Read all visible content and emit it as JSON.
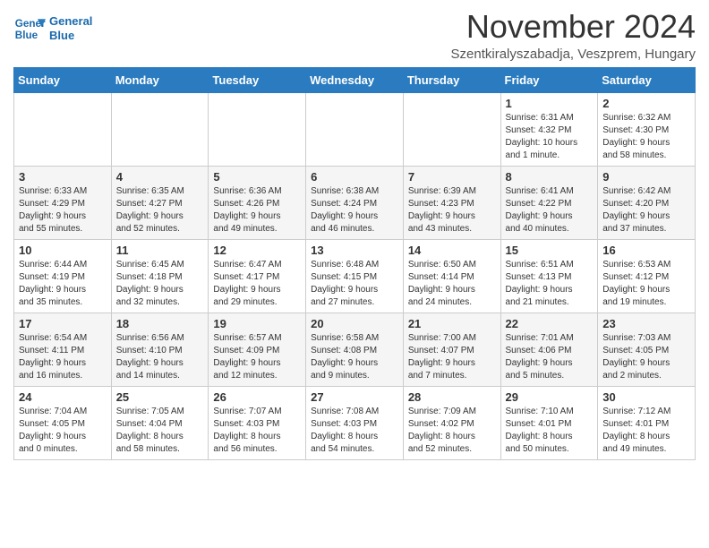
{
  "logo": {
    "line1": "General",
    "line2": "Blue"
  },
  "header": {
    "month": "November 2024",
    "location": "Szentkiralyszabadja, Veszprem, Hungary"
  },
  "weekdays": [
    "Sunday",
    "Monday",
    "Tuesday",
    "Wednesday",
    "Thursday",
    "Friday",
    "Saturday"
  ],
  "weeks": [
    [
      {
        "day": "",
        "info": ""
      },
      {
        "day": "",
        "info": ""
      },
      {
        "day": "",
        "info": ""
      },
      {
        "day": "",
        "info": ""
      },
      {
        "day": "",
        "info": ""
      },
      {
        "day": "1",
        "info": "Sunrise: 6:31 AM\nSunset: 4:32 PM\nDaylight: 10 hours\nand 1 minute."
      },
      {
        "day": "2",
        "info": "Sunrise: 6:32 AM\nSunset: 4:30 PM\nDaylight: 9 hours\nand 58 minutes."
      }
    ],
    [
      {
        "day": "3",
        "info": "Sunrise: 6:33 AM\nSunset: 4:29 PM\nDaylight: 9 hours\nand 55 minutes."
      },
      {
        "day": "4",
        "info": "Sunrise: 6:35 AM\nSunset: 4:27 PM\nDaylight: 9 hours\nand 52 minutes."
      },
      {
        "day": "5",
        "info": "Sunrise: 6:36 AM\nSunset: 4:26 PM\nDaylight: 9 hours\nand 49 minutes."
      },
      {
        "day": "6",
        "info": "Sunrise: 6:38 AM\nSunset: 4:24 PM\nDaylight: 9 hours\nand 46 minutes."
      },
      {
        "day": "7",
        "info": "Sunrise: 6:39 AM\nSunset: 4:23 PM\nDaylight: 9 hours\nand 43 minutes."
      },
      {
        "day": "8",
        "info": "Sunrise: 6:41 AM\nSunset: 4:22 PM\nDaylight: 9 hours\nand 40 minutes."
      },
      {
        "day": "9",
        "info": "Sunrise: 6:42 AM\nSunset: 4:20 PM\nDaylight: 9 hours\nand 37 minutes."
      }
    ],
    [
      {
        "day": "10",
        "info": "Sunrise: 6:44 AM\nSunset: 4:19 PM\nDaylight: 9 hours\nand 35 minutes."
      },
      {
        "day": "11",
        "info": "Sunrise: 6:45 AM\nSunset: 4:18 PM\nDaylight: 9 hours\nand 32 minutes."
      },
      {
        "day": "12",
        "info": "Sunrise: 6:47 AM\nSunset: 4:17 PM\nDaylight: 9 hours\nand 29 minutes."
      },
      {
        "day": "13",
        "info": "Sunrise: 6:48 AM\nSunset: 4:15 PM\nDaylight: 9 hours\nand 27 minutes."
      },
      {
        "day": "14",
        "info": "Sunrise: 6:50 AM\nSunset: 4:14 PM\nDaylight: 9 hours\nand 24 minutes."
      },
      {
        "day": "15",
        "info": "Sunrise: 6:51 AM\nSunset: 4:13 PM\nDaylight: 9 hours\nand 21 minutes."
      },
      {
        "day": "16",
        "info": "Sunrise: 6:53 AM\nSunset: 4:12 PM\nDaylight: 9 hours\nand 19 minutes."
      }
    ],
    [
      {
        "day": "17",
        "info": "Sunrise: 6:54 AM\nSunset: 4:11 PM\nDaylight: 9 hours\nand 16 minutes."
      },
      {
        "day": "18",
        "info": "Sunrise: 6:56 AM\nSunset: 4:10 PM\nDaylight: 9 hours\nand 14 minutes."
      },
      {
        "day": "19",
        "info": "Sunrise: 6:57 AM\nSunset: 4:09 PM\nDaylight: 9 hours\nand 12 minutes."
      },
      {
        "day": "20",
        "info": "Sunrise: 6:58 AM\nSunset: 4:08 PM\nDaylight: 9 hours\nand 9 minutes."
      },
      {
        "day": "21",
        "info": "Sunrise: 7:00 AM\nSunset: 4:07 PM\nDaylight: 9 hours\nand 7 minutes."
      },
      {
        "day": "22",
        "info": "Sunrise: 7:01 AM\nSunset: 4:06 PM\nDaylight: 9 hours\nand 5 minutes."
      },
      {
        "day": "23",
        "info": "Sunrise: 7:03 AM\nSunset: 4:05 PM\nDaylight: 9 hours\nand 2 minutes."
      }
    ],
    [
      {
        "day": "24",
        "info": "Sunrise: 7:04 AM\nSunset: 4:05 PM\nDaylight: 9 hours\nand 0 minutes."
      },
      {
        "day": "25",
        "info": "Sunrise: 7:05 AM\nSunset: 4:04 PM\nDaylight: 8 hours\nand 58 minutes."
      },
      {
        "day": "26",
        "info": "Sunrise: 7:07 AM\nSunset: 4:03 PM\nDaylight: 8 hours\nand 56 minutes."
      },
      {
        "day": "27",
        "info": "Sunrise: 7:08 AM\nSunset: 4:03 PM\nDaylight: 8 hours\nand 54 minutes."
      },
      {
        "day": "28",
        "info": "Sunrise: 7:09 AM\nSunset: 4:02 PM\nDaylight: 8 hours\nand 52 minutes."
      },
      {
        "day": "29",
        "info": "Sunrise: 7:10 AM\nSunset: 4:01 PM\nDaylight: 8 hours\nand 50 minutes."
      },
      {
        "day": "30",
        "info": "Sunrise: 7:12 AM\nSunset: 4:01 PM\nDaylight: 8 hours\nand 49 minutes."
      }
    ]
  ]
}
